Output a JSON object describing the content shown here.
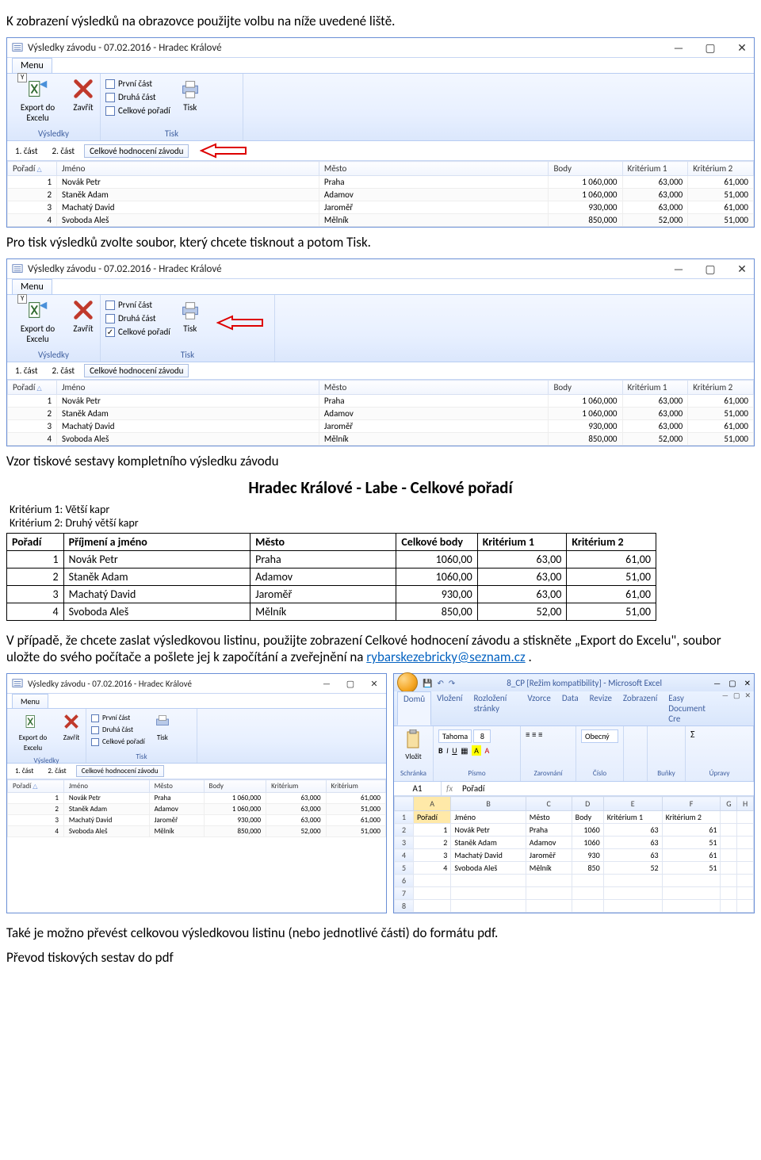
{
  "p1": "K zobrazení výsledků na obrazovce použijte volbu na níže uvedené liště.",
  "p2": "Pro tisk výsledků zvolte soubor, který chcete tisknout a potom Tisk.",
  "p3": "Vzor tiskové sestavy kompletního výsledku závodu",
  "p4a": "V případě, že chcete zaslat výsledkovou listinu, použijte zobrazení Celkové hodnocení závodu a stiskněte „Export do Excelu\", soubor uložte do svého počítače a pošlete jej k započítání a zveřejnění na ",
  "p4link": "rybarskezebricky@seznam.cz",
  "p4b": " .",
  "p5": "Také je možno převést celkovou výsledkovou listinu (nebo jednotlivé části) do formátu pdf.",
  "p6": "Převod tiskových sestav do pdf",
  "wintitle": "Výsledky závodu - 07.02.2016 - Hradec Králové",
  "menu": "Menu",
  "menukey": "Y",
  "exportExcel": "Export do Excelu",
  "zavrit": "Zavřít",
  "grpVysledky": "Výsledky",
  "chk1": "První část",
  "chk2": "Druhá část",
  "chk3": "Celkové pořadí",
  "tiskBtn": "Tisk",
  "grpTisk": "Tisk",
  "subtab1": "1. část",
  "subtab2": "2. část",
  "subtab3": "Celkové hodnocení závodu",
  "gridCols": [
    "Pořadí",
    "Jméno",
    "Město",
    "Body",
    "Kritérium 1",
    "Kritérium 2"
  ],
  "rows": [
    {
      "p": "1",
      "j": "Novák Petr",
      "m": "Praha",
      "b": "1 060,000",
      "k1": "63,000",
      "k2": "61,000"
    },
    {
      "p": "2",
      "j": "Staněk Adam",
      "m": "Adamov",
      "b": "1 060,000",
      "k1": "63,000",
      "k2": "51,000"
    },
    {
      "p": "3",
      "j": "Machatý David",
      "m": "Jaroměř",
      "b": "930,000",
      "k1": "63,000",
      "k2": "61,000"
    },
    {
      "p": "4",
      "j": "Svoboda Aleš",
      "m": "Mělník",
      "b": "850,000",
      "k1": "52,000",
      "k2": "51,000"
    }
  ],
  "report": {
    "title": "Hradec Králové - Labe - Celkové pořadí",
    "crit1": "Kritérium 1: Větší kapr",
    "crit2": "Kritérium 2: Druhý větší kapr",
    "cols": [
      "Pořadí",
      "Příjmení a jméno",
      "Město",
      "Celkové body",
      "Kritérium 1",
      "Kritérium 2"
    ],
    "rows": [
      {
        "p": "1",
        "j": "Novák Petr",
        "m": "Praha",
        "b": "1060,00",
        "k1": "63,00",
        "k2": "61,00"
      },
      {
        "p": "2",
        "j": "Staněk Adam",
        "m": "Adamov",
        "b": "1060,00",
        "k1": "63,00",
        "k2": "51,00"
      },
      {
        "p": "3",
        "j": "Machatý David",
        "m": "Jaroměř",
        "b": "930,00",
        "k1": "63,00",
        "k2": "61,00"
      },
      {
        "p": "4",
        "j": "Svoboda Aleš",
        "m": "Mělník",
        "b": "850,00",
        "k1": "52,00",
        "k2": "51,00"
      }
    ]
  },
  "excel": {
    "title": "8_CP [Režim kompatibility] - Microsoft Excel",
    "tabs": [
      "Domů",
      "Vložení",
      "Rozložení stránky",
      "Vzorce",
      "Data",
      "Revize",
      "Zobrazení",
      "Easy Document Cre"
    ],
    "groups": [
      "Schránka",
      "Písmo",
      "Zarovnání",
      "Číslo",
      "",
      "Buňky",
      "Úpravy"
    ],
    "font": "Tahoma",
    "size": "8",
    "numfmt": "Obecný",
    "nmcell": "A1",
    "fxval": "Pořadí",
    "cols": [
      "A",
      "B",
      "C",
      "D",
      "E",
      "F",
      "G",
      "H"
    ],
    "hdr": [
      "Pořadí",
      "Jméno",
      "Město",
      "Body",
      "Kritérium 1",
      "Kritérium 2"
    ],
    "rows": [
      {
        "p": "1",
        "j": "Novák Petr",
        "m": "Praha",
        "b": "1060",
        "k1": "63",
        "k2": "61"
      },
      {
        "p": "2",
        "j": "Staněk Adam",
        "m": "Adamov",
        "b": "1060",
        "k1": "63",
        "k2": "51"
      },
      {
        "p": "3",
        "j": "Machatý David",
        "m": "Jaroměř",
        "b": "930",
        "k1": "63",
        "k2": "61"
      },
      {
        "p": "4",
        "j": "Svoboda Aleš",
        "m": "Mělník",
        "b": "850",
        "k1": "52",
        "k2": "51"
      }
    ]
  }
}
